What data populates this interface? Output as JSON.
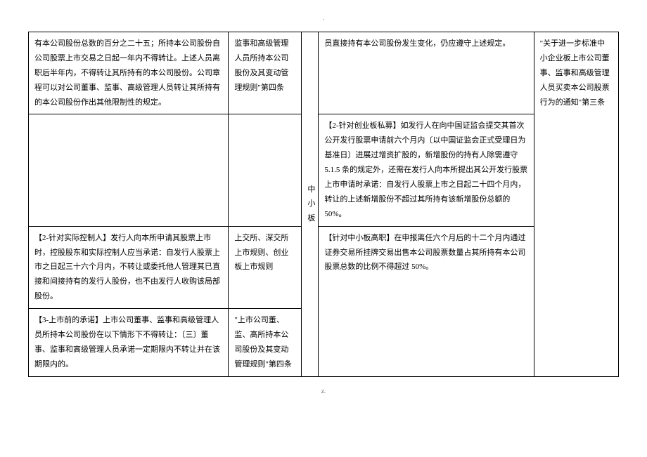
{
  "page_marker_top": ".",
  "page_marker_bottom": "z.",
  "rows": {
    "r1c1": "有本公司股份总数的百分之二十五；所持本公司股份自公司股票上市交易之日起一年内不得转让。上述人员离职后半年内，不得转让其所持有的本公司股份。公司章程可以对公司董事、监事、高级管理人员转让其所持有的本公司股份作出其他限制性的规定。",
    "r1c2": "监事和高级管理人员所持本公司股份及其变动管理规则\"第四条",
    "r1c4": "员直接持有本公司股份发生变化，仍应遵守上述规定。",
    "r2c4": "【2-针对创业板私募】如发行人在向中国证监会提交其首次公开发行股票申请前六个月内〔以中国证监会正式受理日为基准日〕进展过增资扩股的，新增股份的持有人除需遵守 5.1.5 条的规定外，还需在发行人向本所提出其公开发行股票上市申请时承诺：自发行人股票上市之日起二十四个月内，转让的上述新增股份不超过其所持有该新增股份总额的 50%。",
    "r3c1": "【2-针对实际控制人】发行人向本所申请其股票上市时，控股股东和实际控制人应当承诺：自发行人股票上市之日起三十六个月内，不转让或委托他人管理其已直接和间接持有的发行人股份，也不由发行人收购该局部股份。",
    "r3c2": "上交所、深交所上市规则、创业板上市规则",
    "r3c3": "中小板",
    "r3c4": "【针对中小板高职】在申报离任六个月后的十二个月内通过证券交易所挂牌交易出售本公司股票数量占其所持有本公司股票总数的比例不得超过 50%。",
    "r3c5": "\"关于进一步标准中小企业板上市公司董事、监事和高级管理人员买卖本公司股票行为的通知\"第三条",
    "r4c1": "【3-上市前的承诺】上市公司董事、监事和高级管理人员所持本公司股份在以下情形下不得转让：〔三〕董事、监事和高级管理人员承诺一定期限内不转让并在该期限内的。",
    "r4c2": "\"上市公司董、监、高所持本公司股份及其变动管理规则\"第四条"
  }
}
